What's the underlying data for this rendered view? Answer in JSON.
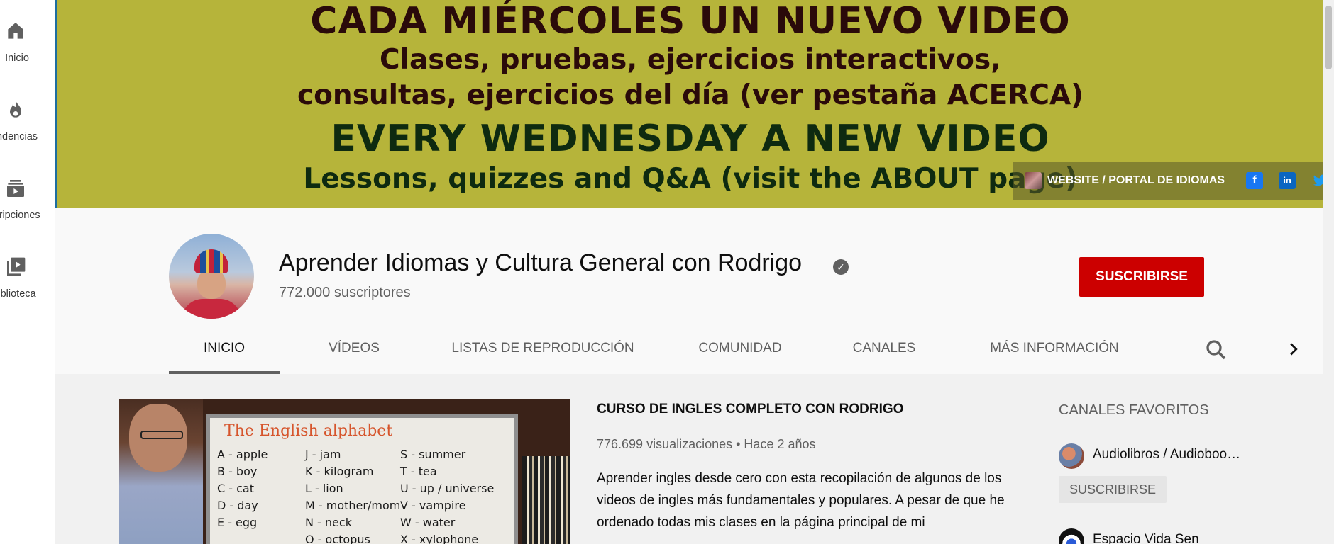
{
  "guide": {
    "items": [
      {
        "label": "Inicio",
        "icon": "home-icon"
      },
      {
        "label": "ndencias",
        "icon": "flame-icon"
      },
      {
        "label": "cripciones",
        "icon": "subscriptions-icon"
      },
      {
        "label": "iblioteca",
        "icon": "library-icon"
      }
    ]
  },
  "banner": {
    "line1": "CADA MIÉRCOLES UN NUEVO VIDEO",
    "line2": "Clases, pruebas, ejercicios interactivos,",
    "line3": "consultas, ejercicios del día (ver pestaña ACERCA)",
    "line4": "EVERY WEDNESDAY A NEW VIDEO",
    "line5": "Lessons, quizzes and Q&A (visit the ABOUT page)",
    "links": {
      "website_label": "WEBSITE / PORTAL DE IDIOMAS",
      "social": [
        {
          "icon": "facebook-icon",
          "glyph": "f"
        },
        {
          "icon": "linkedin-icon",
          "glyph": "in"
        },
        {
          "icon": "twitter-icon",
          "glyph": "🐦"
        },
        {
          "icon": "instagram-icon",
          "glyph": "◎"
        }
      ]
    }
  },
  "channel": {
    "title": "Aprender Idiomas y Cultura General con Rodrigo",
    "verified_glyph": "✓",
    "subscribers": "772.000 suscriptores",
    "subscribe_label": "SUSCRIBIRSE"
  },
  "tabs": [
    {
      "label": "INICIO",
      "active": true
    },
    {
      "label": "VÍDEOS",
      "active": false
    },
    {
      "label": "LISTAS DE REPRODUCCIÓN",
      "active": false
    },
    {
      "label": "COMUNIDAD",
      "active": false
    },
    {
      "label": "CANALES",
      "active": false
    },
    {
      "label": "MÁS INFORMACIÓN",
      "active": false
    }
  ],
  "featured_video": {
    "title": "CURSO DE INGLES COMPLETO CON RODRIGO",
    "meta": "776.699 visualizaciones • Hace 2 años",
    "description": "Aprender ingles desde cero con esta recopilación de algunos de los videos de ingles más fundamentales y populares. A pesar de que he ordenado todas mis clases en la página principal de mi",
    "thumbnail": {
      "board_title": "The English alphabet",
      "col1": "A - apple\nB - boy\nC - cat\nD - day\nE - egg",
      "col2": "J - jam\nK - kilogram\nL - lion\nM - mother/mom\nN - neck\nO - octopus",
      "col3": "S - summer\nT - tea\nU - up / universe\nV - vampire\nW - water\nX - xylophone"
    }
  },
  "favorites": {
    "heading": "CANALES FAVORITOS",
    "items": [
      {
        "name": "Audiolibros / Audioboo…",
        "subscribe_label": "SUSCRIBIRSE"
      },
      {
        "name": "Espacio Vida Sen"
      }
    ]
  },
  "colors": {
    "banner_bg": "#b6b43a",
    "subscribe_red": "#cc0000",
    "tab_active_underline": "#606060"
  }
}
